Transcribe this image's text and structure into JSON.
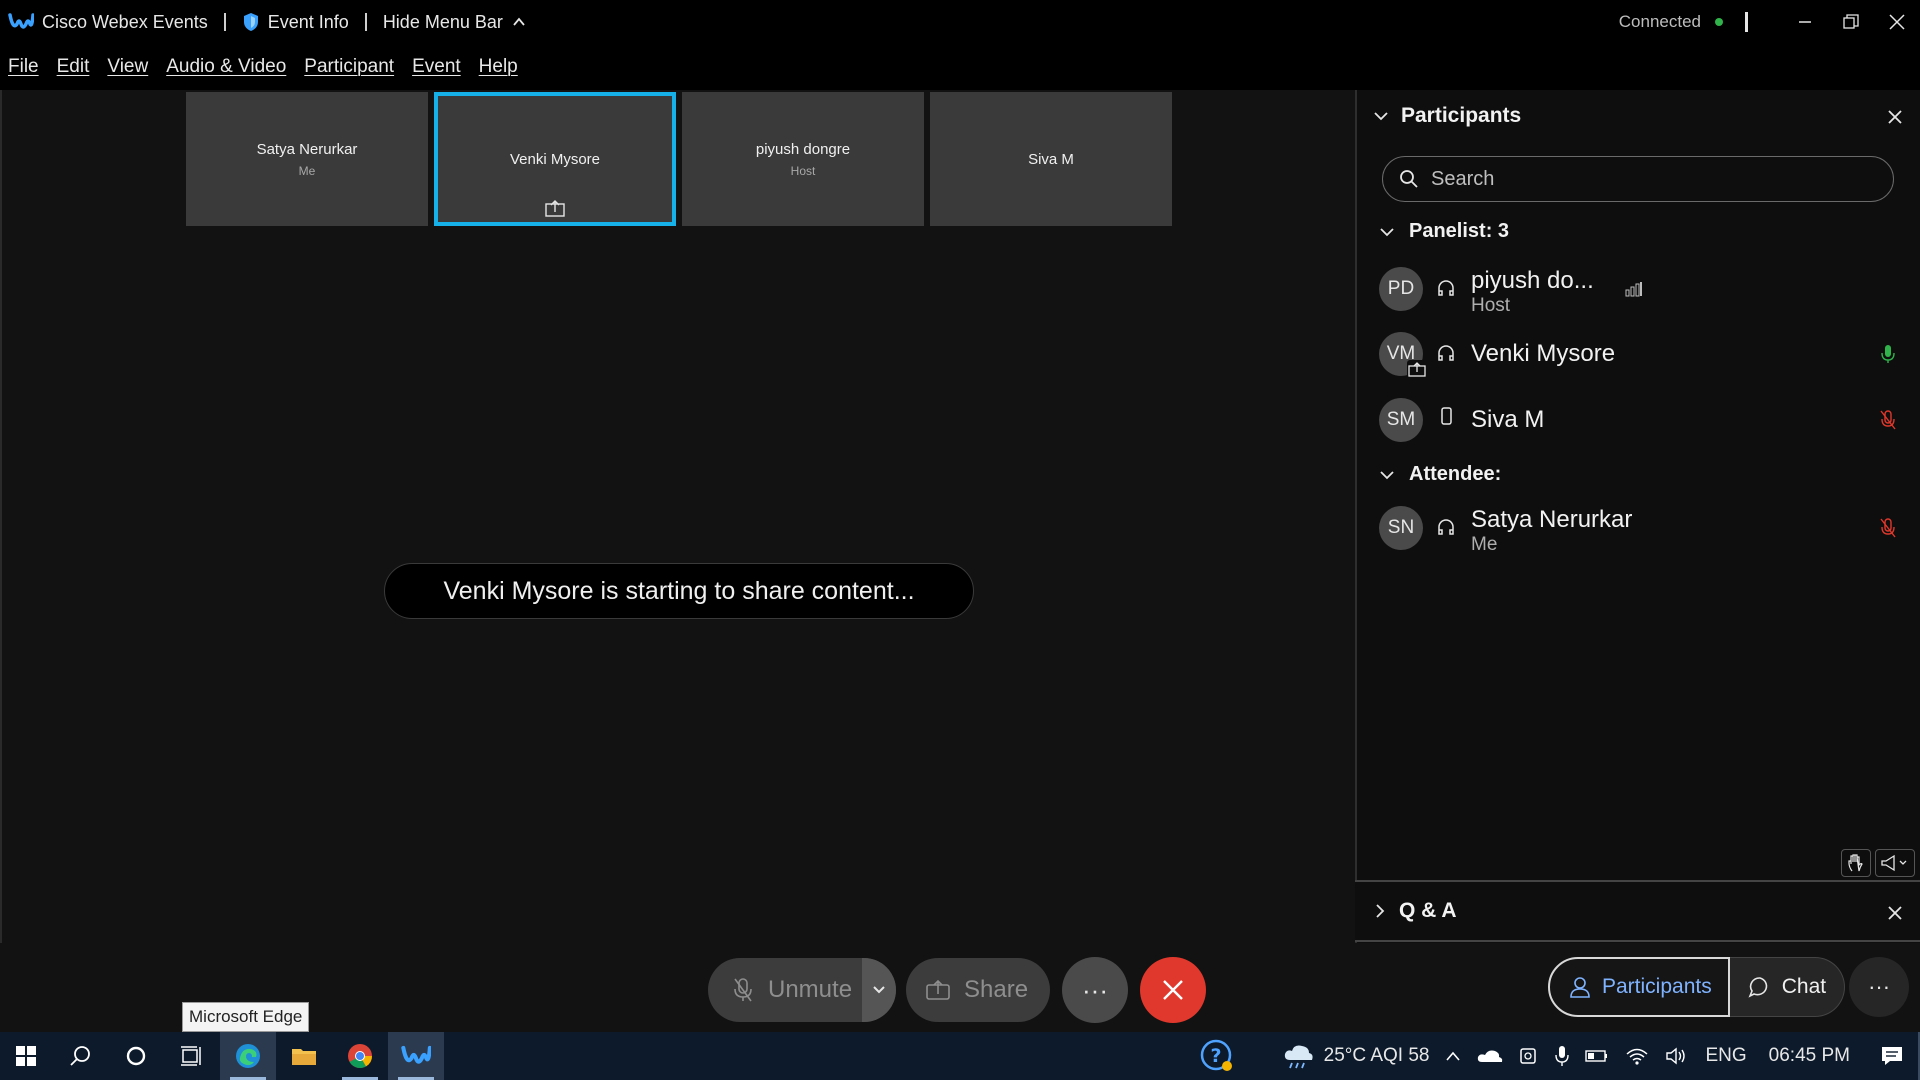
{
  "titlebar": {
    "app_name": "Cisco Webex Events",
    "event_info": "Event Info",
    "hide_menu": "Hide Menu Bar",
    "status": "Connected",
    "status_color": "#2fb34a"
  },
  "menu": [
    "File",
    "Edit",
    "View",
    "Audio & Video",
    "Participant",
    "Event",
    "Help"
  ],
  "thumbnails": [
    {
      "name": "Satya Nerurkar",
      "sub": "Me"
    },
    {
      "name": "Venki Mysore",
      "sub": ""
    },
    {
      "name": "piyush dongre",
      "sub": "Host"
    },
    {
      "name": "Siva M",
      "sub": ""
    }
  ],
  "toast": "Venki Mysore is starting to share content...",
  "controls": {
    "unmute": "Unmute",
    "share": "Share",
    "more": "···"
  },
  "participants_panel": {
    "title": "Participants",
    "search_placeholder": "Search",
    "panelist_header": "Panelist: 3",
    "attendee_header": "Attendee:",
    "panelists": [
      {
        "initials": "PD",
        "name": "piyush do...",
        "role": "Host"
      },
      {
        "initials": "VM",
        "name": "Venki Mysore",
        "role": ""
      },
      {
        "initials": "SM",
        "name": "Siva M",
        "role": ""
      }
    ],
    "attendees": [
      {
        "initials": "SN",
        "name": "Satya Nerurkar",
        "role": "Me"
      }
    ]
  },
  "qa": {
    "title": "Q & A"
  },
  "tabs": {
    "participants": "Participants",
    "chat": "Chat",
    "more": "···"
  },
  "tooltip": "Microsoft Edge",
  "tray": {
    "weather": "25°C AQI 58",
    "lang": "ENG",
    "time": "06:45 PM"
  },
  "colors": {
    "accent": "#16b1e8",
    "leave": "#e0382c",
    "mic_on": "#2fb34a",
    "muted": "#e0382c"
  }
}
